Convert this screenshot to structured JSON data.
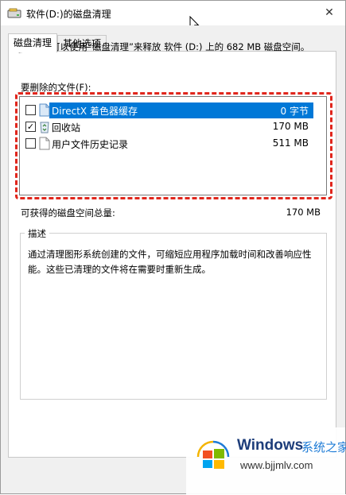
{
  "window": {
    "title": "软件(D:)的磁盘清理",
    "close_glyph": "✕"
  },
  "tabs": [
    {
      "label": "磁盘清理",
      "active": true
    },
    {
      "label": "其他选项",
      "active": false
    }
  ],
  "info": {
    "text": "可以使用“磁盘清理”来释放 软件 (D:) 上的 682 MB 磁盘空间。"
  },
  "files_to_delete": {
    "label": "要删除的文件(F):",
    "items": [
      {
        "label": "DirectX 着色器缓存",
        "size": "0 字节",
        "checked": false,
        "selected": true,
        "icon": "document-icon"
      },
      {
        "label": "回收站",
        "size": "170 MB",
        "checked": true,
        "selected": false,
        "icon": "recycle-bin-icon"
      },
      {
        "label": "用户文件历史记录",
        "size": "511 MB",
        "checked": false,
        "selected": false,
        "icon": "blank-file-icon"
      }
    ]
  },
  "total": {
    "label": "可获得的磁盘空间总量:",
    "value": "170 MB"
  },
  "description": {
    "title": "描述",
    "text": "通过清理图形系统创建的文件，可缩短应用程序加载时间和改善响应性能。这些已清理的文件将在需要时重新生成。"
  },
  "watermark": {
    "title": "Windows",
    "subtitle": "系统之家",
    "url": "www.bjjmlv.com"
  },
  "colors": {
    "selection": "#0078d7",
    "highlight_border": "#e0261c",
    "panel_background": "#f0f0f0"
  }
}
